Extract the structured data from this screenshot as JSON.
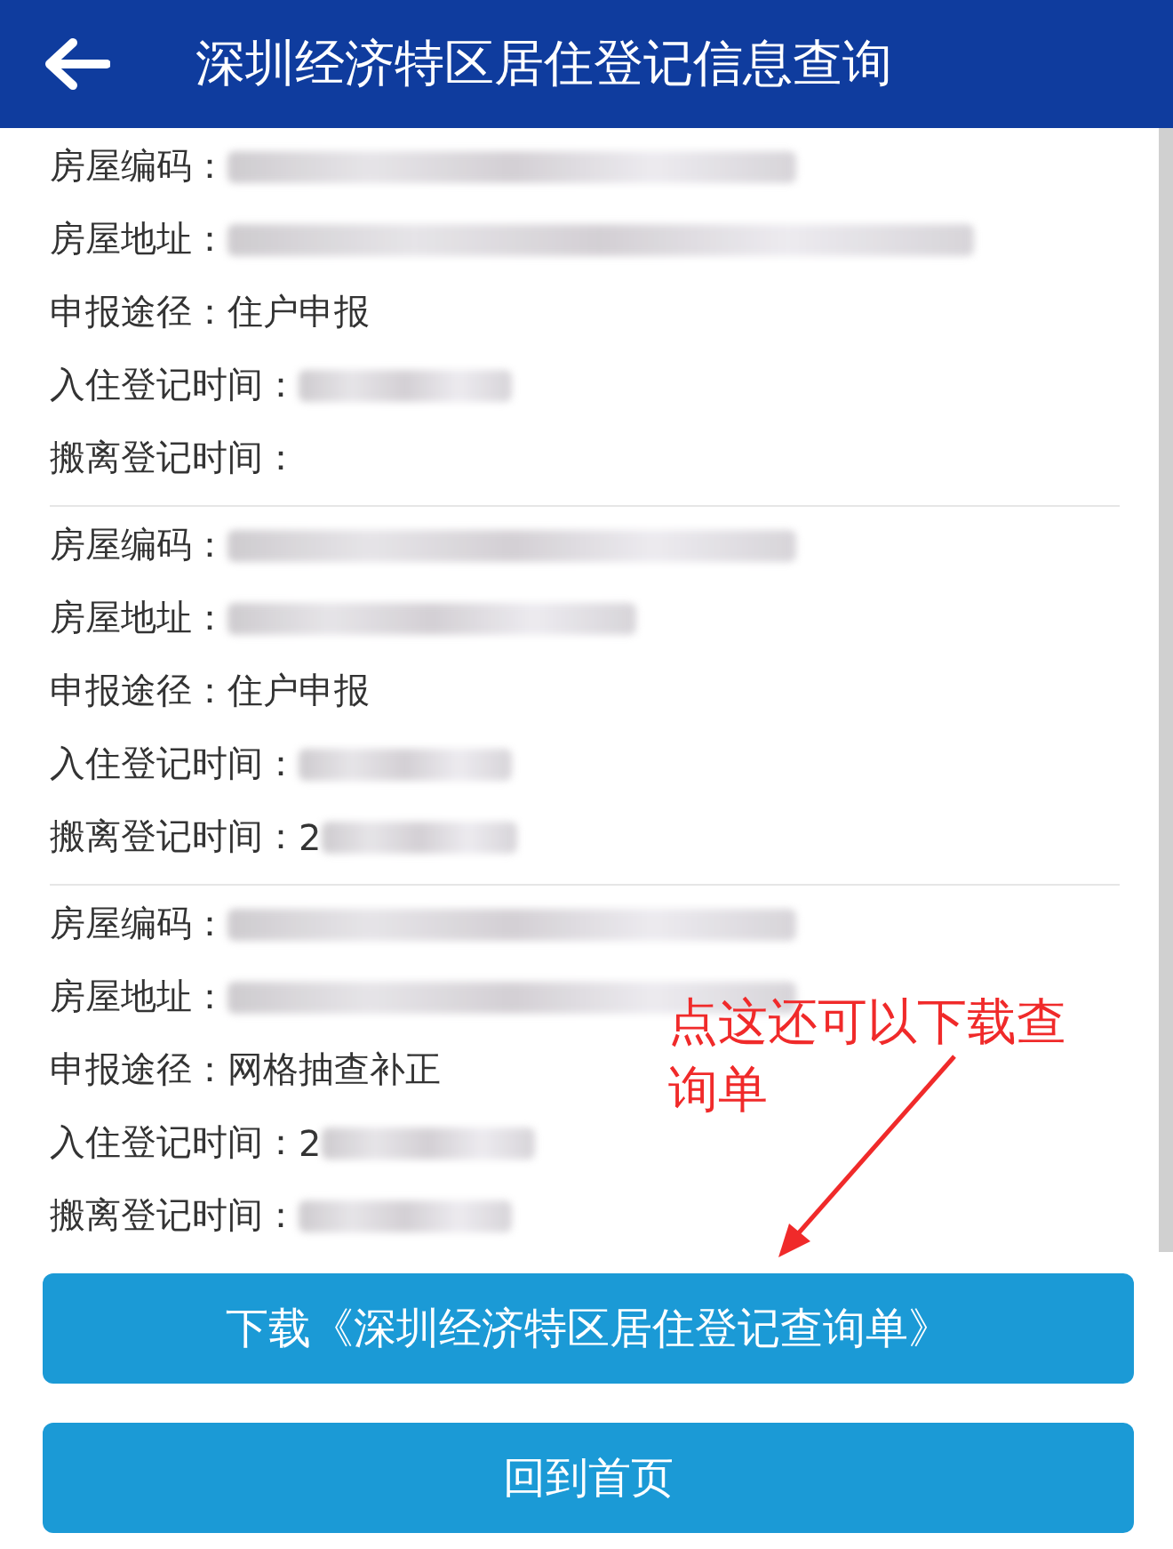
{
  "header": {
    "title": "深圳经济特区居住登记信息查询"
  },
  "records": [
    {
      "fields": [
        {
          "label": "房屋编码：",
          "blurred": true
        },
        {
          "label": "房屋地址：",
          "blurred": true
        },
        {
          "label": "申报途径：",
          "value": "住户申报",
          "blurred": false
        },
        {
          "label": "入住登记时间：",
          "blurred": true
        },
        {
          "label": "搬离登记时间：",
          "blurred": false
        }
      ]
    },
    {
      "fields": [
        {
          "label": "房屋编码：",
          "blurred": true
        },
        {
          "label": "房屋地址：",
          "blurred": true
        },
        {
          "label": "申报途径：",
          "value": "住户申报",
          "blurred": false
        },
        {
          "label": "入住登记时间：",
          "blurred": true
        },
        {
          "label": "搬离登记时间：",
          "value": "2",
          "blurred": true
        }
      ]
    },
    {
      "fields": [
        {
          "label": "房屋编码：",
          "blurred": true
        },
        {
          "label": "房屋地址：",
          "blurred": true
        },
        {
          "label": "申报途径：",
          "value": "网格抽查补正",
          "blurred": false
        },
        {
          "label": "入住登记时间：",
          "value": "2",
          "blurred": true
        },
        {
          "label": "搬离登记时间：",
          "blurred": true
        }
      ]
    }
  ],
  "buttons": [
    {
      "label": "下载《深圳经济特区居住登记查询单》"
    },
    {
      "label": "回到首页"
    }
  ],
  "annotation": {
    "text": "点这还可以下载查询单"
  }
}
